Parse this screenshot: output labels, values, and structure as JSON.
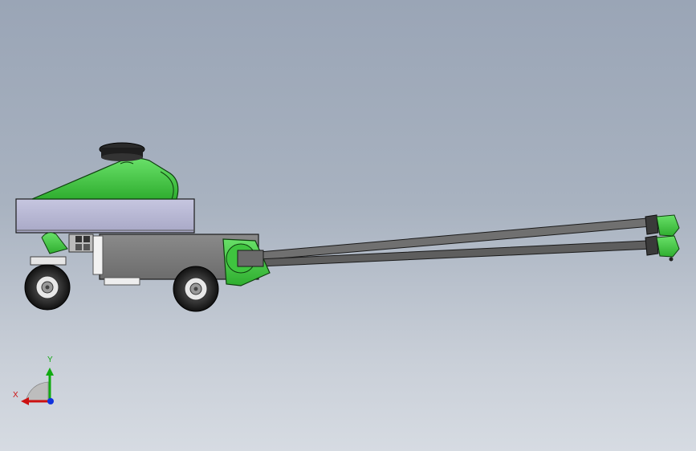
{
  "viewport": {
    "background_top": "#9aa5b6",
    "background_bottom": "#d6dbe2"
  },
  "model": {
    "part_color_green": "#4fd14f",
    "part_color_dark_green": "#1d8f1d",
    "body_color_gray": "#7f7f7f",
    "platform_color": "#b9b9d6",
    "tire_color": "#2b2b2b"
  },
  "triad": {
    "x_label": "X",
    "y_label": "Y",
    "x_color": "#cc1111",
    "y_color": "#11aa11",
    "z_color": "#1133dd"
  }
}
